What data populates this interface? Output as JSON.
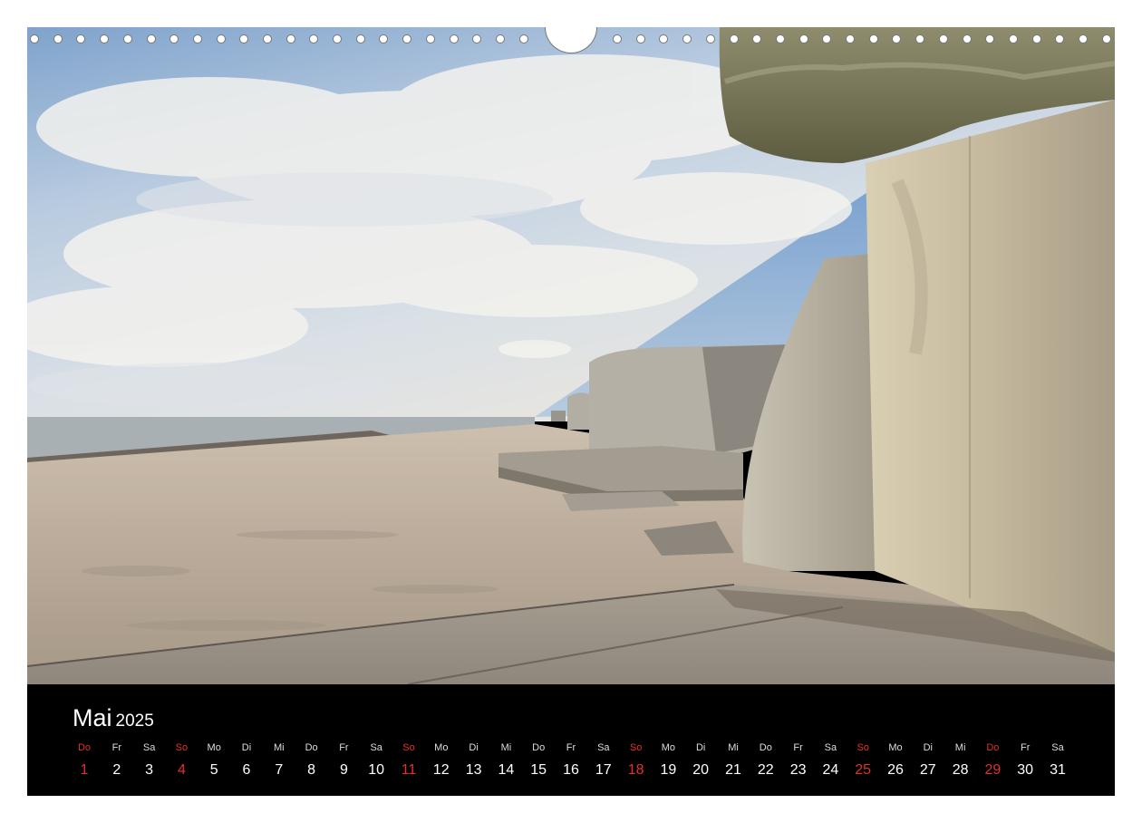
{
  "calendar": {
    "month": "Mai",
    "year": "2025",
    "weekday_color_sunday": "#e0322b",
    "days": [
      {
        "wd": "Do",
        "d": "1",
        "red": true
      },
      {
        "wd": "Fr",
        "d": "2",
        "red": false
      },
      {
        "wd": "Sa",
        "d": "3",
        "red": false
      },
      {
        "wd": "So",
        "d": "4",
        "red": true
      },
      {
        "wd": "Mo",
        "d": "5",
        "red": false
      },
      {
        "wd": "Di",
        "d": "6",
        "red": false
      },
      {
        "wd": "Mi",
        "d": "7",
        "red": false
      },
      {
        "wd": "Do",
        "d": "8",
        "red": false
      },
      {
        "wd": "Fr",
        "d": "9",
        "red": false
      },
      {
        "wd": "Sa",
        "d": "10",
        "red": false
      },
      {
        "wd": "So",
        "d": "11",
        "red": true
      },
      {
        "wd": "Mo",
        "d": "12",
        "red": false
      },
      {
        "wd": "Di",
        "d": "13",
        "red": false
      },
      {
        "wd": "Mi",
        "d": "14",
        "red": false
      },
      {
        "wd": "Do",
        "d": "15",
        "red": false
      },
      {
        "wd": "Fr",
        "d": "16",
        "red": false
      },
      {
        "wd": "Sa",
        "d": "17",
        "red": false
      },
      {
        "wd": "So",
        "d": "18",
        "red": true
      },
      {
        "wd": "Mo",
        "d": "19",
        "red": false
      },
      {
        "wd": "Di",
        "d": "20",
        "red": false
      },
      {
        "wd": "Mi",
        "d": "21",
        "red": false
      },
      {
        "wd": "Do",
        "d": "22",
        "red": false
      },
      {
        "wd": "Fr",
        "d": "23",
        "red": false
      },
      {
        "wd": "Sa",
        "d": "24",
        "red": false
      },
      {
        "wd": "So",
        "d": "25",
        "red": true
      },
      {
        "wd": "Mo",
        "d": "26",
        "red": false
      },
      {
        "wd": "Di",
        "d": "27",
        "red": false
      },
      {
        "wd": "Mi",
        "d": "28",
        "red": false
      },
      {
        "wd": "Do",
        "d": "29",
        "red": true
      },
      {
        "wd": "Fr",
        "d": "30",
        "red": false
      },
      {
        "wd": "Sa",
        "d": "31",
        "red": false
      }
    ]
  }
}
